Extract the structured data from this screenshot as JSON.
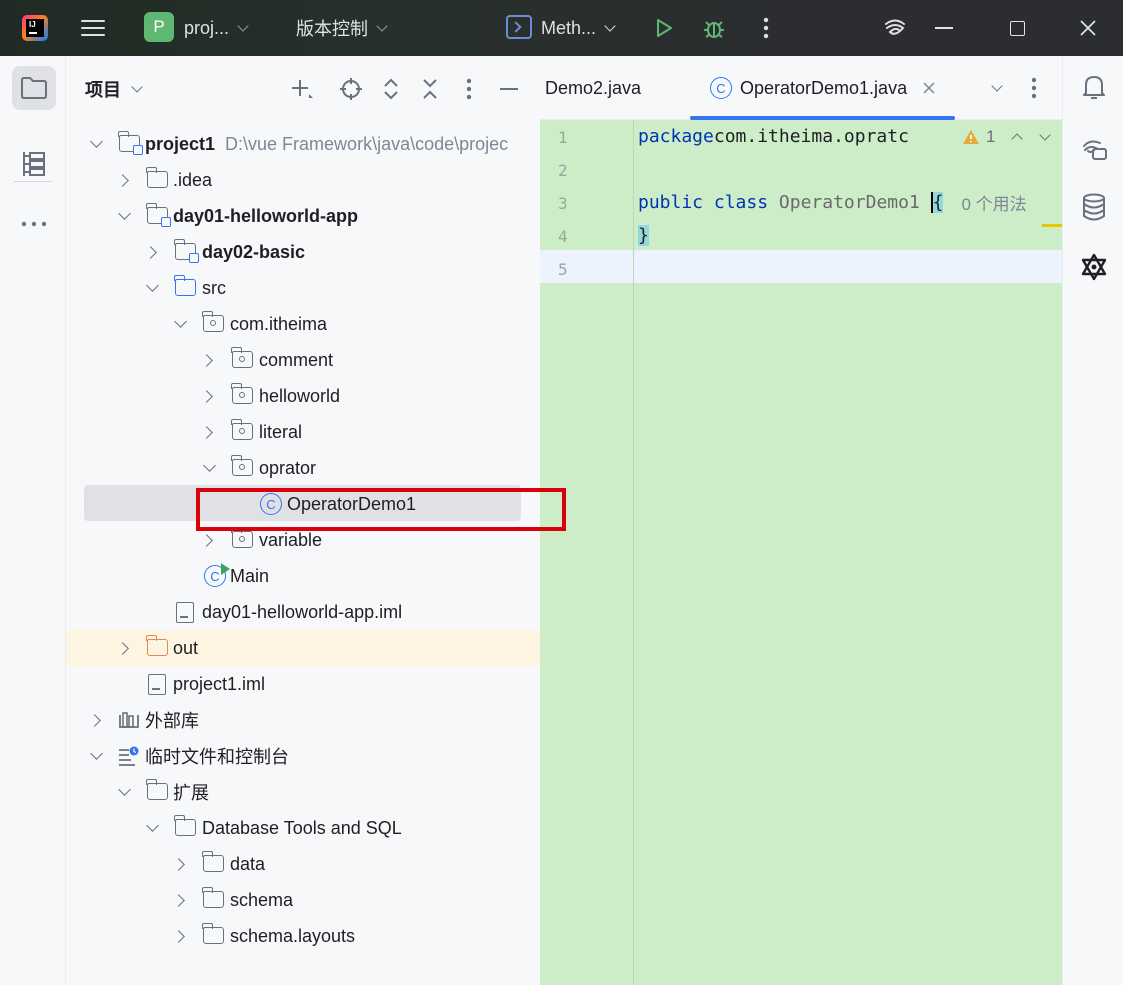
{
  "titlebar": {
    "project_badge": "P",
    "project_name": "proj...",
    "vcs_label": "版本控制",
    "run_config": "Meth..."
  },
  "left_strip": {
    "items": [
      "folder-icon",
      "structure-icon",
      "more-icon"
    ]
  },
  "project_panel": {
    "title": "项目",
    "tree": [
      {
        "label": "project1",
        "path": "D:\\vue  Framework\\java\\code\\projec"
      },
      {
        "label": ".idea"
      },
      {
        "label": "day01-helloworld-app"
      },
      {
        "label": "day02-basic"
      },
      {
        "label": "src"
      },
      {
        "label": "com.itheima"
      },
      {
        "label": "comment"
      },
      {
        "label": "helloworld"
      },
      {
        "label": "literal"
      },
      {
        "label": "oprator"
      },
      {
        "label": "OperatorDemo1"
      },
      {
        "label": "variable"
      },
      {
        "label": "Main"
      },
      {
        "label": "day01-helloworld-app.iml"
      },
      {
        "label": "out"
      },
      {
        "label": "project1.iml"
      },
      {
        "label": "外部库"
      },
      {
        "label": "临时文件和控制台"
      },
      {
        "label": "扩展"
      },
      {
        "label": "Database Tools and SQL"
      },
      {
        "label": "data"
      },
      {
        "label": "schema"
      },
      {
        "label": "schema.layouts"
      }
    ]
  },
  "editor": {
    "tabs": [
      {
        "label": "Demo2.java"
      },
      {
        "label": "OperatorDemo1.java"
      }
    ],
    "line_numbers": [
      "1",
      "2",
      "3",
      "4",
      "5"
    ],
    "code": {
      "line1_kw": "package",
      "line1_rest": " com.itheima.opratc",
      "line3_kw1": "public",
      "line3_kw2": "class",
      "line3_name": "OperatorDemo1",
      "line3_brace": "{",
      "line3_inlay": "0 个用法",
      "line4_brace": "}"
    },
    "warning_count": "1"
  },
  "colors": {
    "editor_bg": "#cdedc9",
    "accent": "#3574f0",
    "highlight_box": "#d9000c"
  }
}
